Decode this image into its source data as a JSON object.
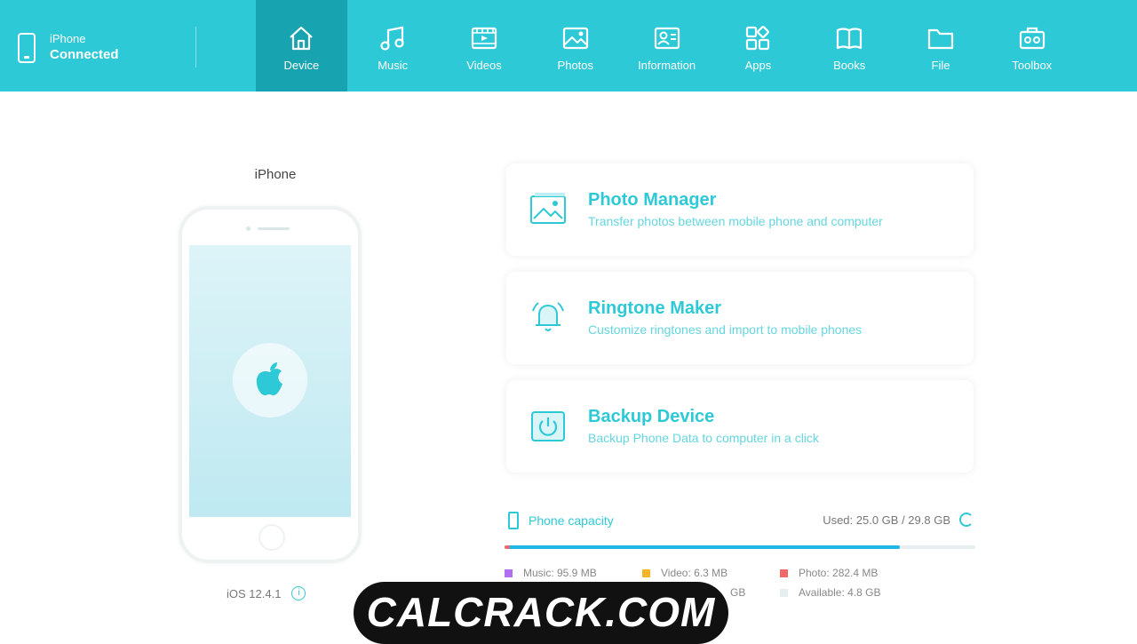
{
  "device_status": {
    "name": "iPhone",
    "state": "Connected"
  },
  "nav": [
    {
      "label": "Device",
      "icon": "home-icon",
      "active": true
    },
    {
      "label": "Music",
      "icon": "music-icon"
    },
    {
      "label": "Videos",
      "icon": "video-icon"
    },
    {
      "label": "Photos",
      "icon": "photo-icon"
    },
    {
      "label": "Information",
      "icon": "contact-card-icon"
    },
    {
      "label": "Apps",
      "icon": "apps-icon"
    },
    {
      "label": "Books",
      "icon": "book-icon"
    },
    {
      "label": "File",
      "icon": "folder-icon"
    },
    {
      "label": "Toolbox",
      "icon": "toolbox-icon"
    }
  ],
  "device": {
    "title": "iPhone",
    "ios_version": "iOS 12.4.1",
    "logo": "apple-logo"
  },
  "cards": [
    {
      "title": "Photo Manager",
      "desc": "Transfer photos between mobile phone and computer",
      "icon": "photo-manager-icon"
    },
    {
      "title": "Ringtone Maker",
      "desc": "Customize ringtones and import to mobile phones",
      "icon": "bell-icon"
    },
    {
      "title": "Backup Device",
      "desc": "Backup Phone Data to computer in a click",
      "icon": "backup-icon"
    }
  ],
  "capacity": {
    "label": "Phone capacity",
    "used": "Used: 25.0 GB / 29.8 GB",
    "used_fraction": 0.84,
    "legend": [
      {
        "label": "Music: 95.9 MB",
        "color": "#b06ef0"
      },
      {
        "label": "Video: 6.3 MB",
        "color": "#f5b52a"
      },
      {
        "label": "Photo: 282.4 MB",
        "color": "#f06a6a"
      },
      {
        "label": "GB",
        "color": "#1fb6e8"
      },
      {
        "label": "Available: 4.8 GB",
        "color": "#e7eef0"
      }
    ]
  },
  "watermark": "CALCRACK.COM",
  "colors": {
    "accent": "#2ec9d6",
    "nav_active": "#17a4b0"
  }
}
